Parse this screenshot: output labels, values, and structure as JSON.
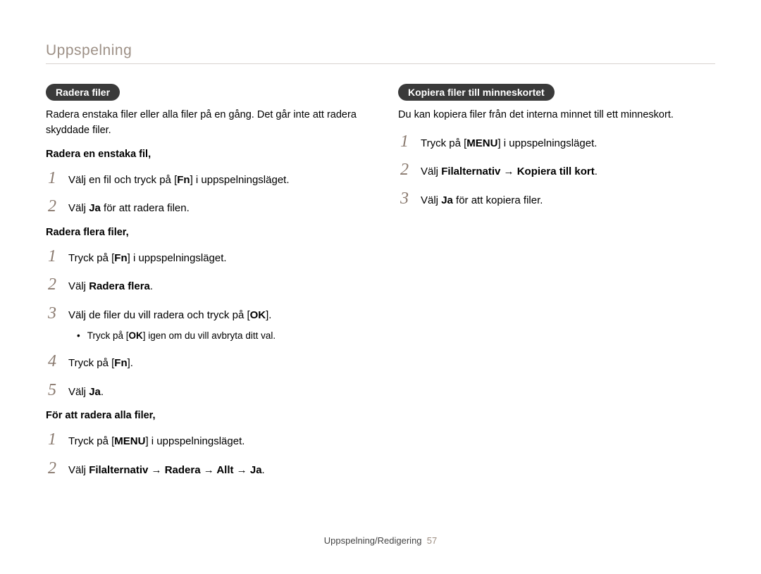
{
  "header": "Uppspelning",
  "left": {
    "pill": "Radera filer",
    "intro": "Radera enstaka filer eller alla filer på en gång. Det går inte att radera skyddade filer.",
    "section1": {
      "title": "Radera en enstaka fil,",
      "steps": [
        {
          "n": "1",
          "pre": "Välj en fil och tryck på [",
          "key": "Fn",
          "post": "] i uppspelningsläget."
        },
        {
          "n": "2",
          "pre": "Välj ",
          "bold": "Ja",
          "post": " för att radera filen."
        }
      ]
    },
    "section2": {
      "title": "Radera flera filer,",
      "steps": [
        {
          "n": "1",
          "pre": "Tryck på [",
          "key": "Fn",
          "post": "] i uppspelningsläget."
        },
        {
          "n": "2",
          "pre": "Välj ",
          "bold": "Radera flera",
          "post": "."
        },
        {
          "n": "3",
          "pre": "Välj de filer du vill radera och tryck på [",
          "key": "OK",
          "post": "]."
        },
        {
          "n": "4",
          "pre": "Tryck på [",
          "key": "Fn",
          "post": "]."
        },
        {
          "n": "5",
          "pre": "Välj ",
          "bold": "Ja",
          "post": "."
        }
      ],
      "subbullet": {
        "pre": "Tryck på [",
        "key": "OK",
        "post": "] igen om du vill avbryta ditt val."
      }
    },
    "section3": {
      "title": "För att radera alla filer,",
      "steps": [
        {
          "n": "1",
          "pre": "Tryck på [",
          "key": "MENU",
          "post": "] i uppspelningsläget."
        },
        {
          "n": "2",
          "pre": "Välj ",
          "bold": "Filalternativ → Radera → Allt → Ja",
          "post": "."
        }
      ]
    }
  },
  "right": {
    "pill": "Kopiera filer till minneskortet",
    "intro": "Du kan kopiera filer från det interna minnet till ett minneskort.",
    "steps": [
      {
        "n": "1",
        "pre": "Tryck på [",
        "key": "MENU",
        "post": "] i uppspelningsläget."
      },
      {
        "n": "2",
        "pre": "Välj ",
        "bold": "Filalternativ → Kopiera till kort",
        "post": "."
      },
      {
        "n": "3",
        "pre": "Välj ",
        "bold": "Ja",
        "post": " för att kopiera filer."
      }
    ]
  },
  "footer": {
    "label": "Uppspelning/Redigering",
    "page": "57"
  }
}
